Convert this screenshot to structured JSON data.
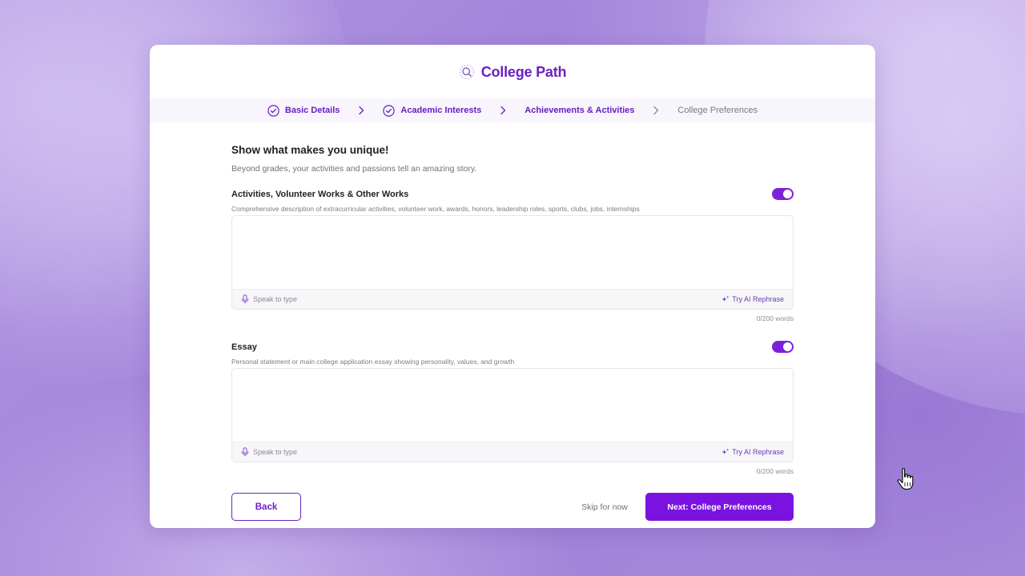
{
  "app": {
    "title": "College Path",
    "accent_color": "#7a13e0",
    "brand_icon": "magnifier-icon"
  },
  "stepper": {
    "steps": [
      {
        "label": "Basic Details",
        "status": "completed",
        "icon": "check-circle-icon"
      },
      {
        "label": "Academic Interests",
        "status": "completed",
        "icon": "check-circle-icon"
      },
      {
        "label": "Achievements & Activities",
        "status": "current"
      },
      {
        "label": "College Preferences",
        "status": "pending"
      }
    ],
    "separator_icon": "chevron-right-icon"
  },
  "page": {
    "heading": "Show what makes you unique!",
    "subheading": "Beyond grades, your activities and passions tell an amazing story."
  },
  "sections": [
    {
      "title": "Activities, Volunteer Works & Other Works",
      "description": "Comprehensive description of extracurricular activities, volunteer work, awards, honors, leadership roles, sports, clubs, jobs, internships",
      "toggle_on": true,
      "value": "",
      "speak_label": "Speak to type",
      "rephrase_label": "Try AI Rephrase",
      "word_count": "0/200 words"
    },
    {
      "title": "Essay",
      "description": "Personal statement or main college application essay showing personality, values, and growth",
      "toggle_on": true,
      "value": "",
      "speak_label": "Speak to type",
      "rephrase_label": "Try AI Rephrase",
      "word_count": "0/200 words"
    }
  ],
  "actions": {
    "back_label": "Back",
    "skip_label": "Skip for now",
    "next_label": "Next: College Preferences"
  }
}
